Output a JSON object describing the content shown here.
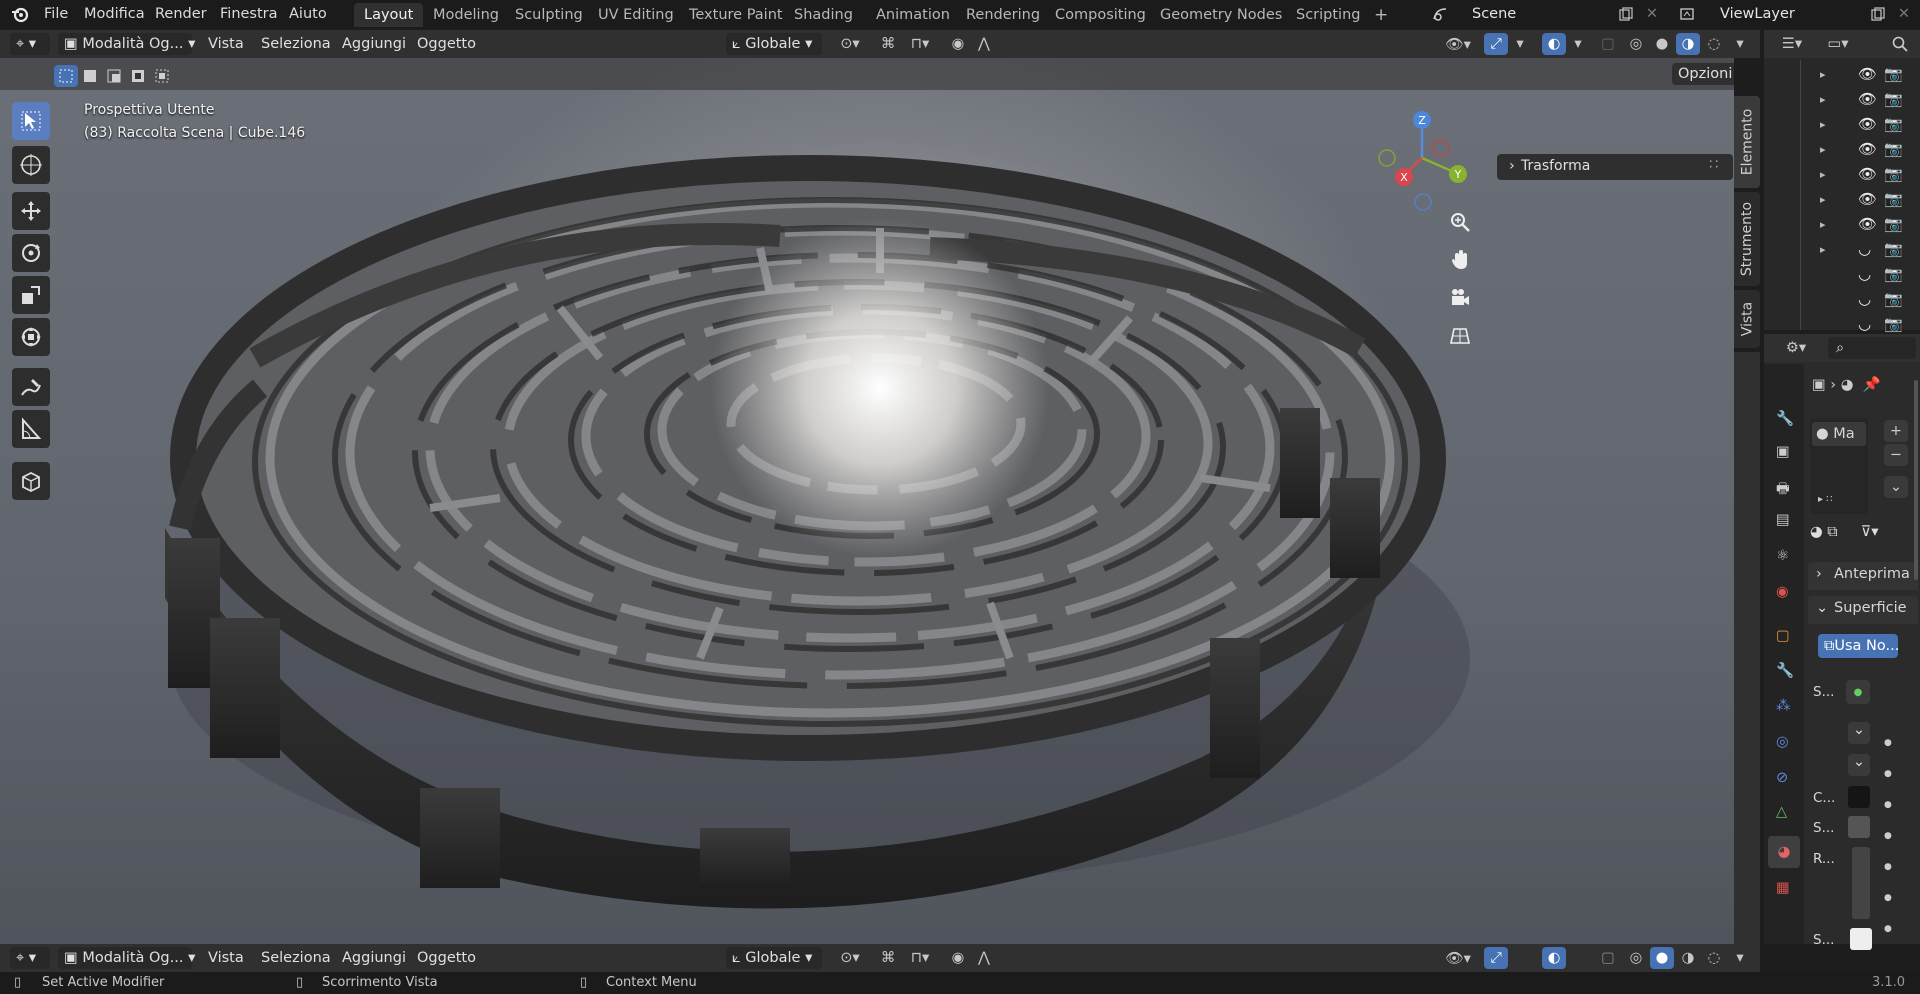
{
  "topbar": {
    "menus": [
      "File",
      "Modifica",
      "Render",
      "Finestra",
      "Aiuto"
    ],
    "workspaces": [
      "Layout",
      "Modeling",
      "Sculpting",
      "UV Editing",
      "Texture Paint",
      "Shading",
      "Animation",
      "Rendering",
      "Compositing",
      "Geometry Nodes",
      "Scripting"
    ],
    "active_workspace": "Layout",
    "add_workspace": "+",
    "scene_label": "Scene",
    "view_layer_label": "ViewLayer"
  },
  "viewport_header": {
    "mode": "Modalità Og...",
    "menus": [
      "Vista",
      "Seleziona",
      "Aggiungi",
      "Oggetto"
    ],
    "transform_orientation": "Globale",
    "options_label": "Opzioni"
  },
  "viewport": {
    "view_name": "Prospettiva Utente",
    "object_info": "(83) Raccolta Scena | Cube.146",
    "npanel_section": "Trasforma",
    "side_tabs": [
      "Elemento",
      "Strumento",
      "Vista"
    ],
    "gizmo_axes": {
      "z": "Z",
      "y": "Y",
      "x": "X"
    }
  },
  "properties": {
    "material_slot": "Ma",
    "preview_panel": "Anteprima",
    "surface_panel": "Superficie",
    "use_nodes_button": "Usa No...",
    "rows": [
      "S...",
      "C...",
      "S...",
      "R...",
      "S..."
    ],
    "colors": {
      "accent": "#4772b3",
      "bg": "#2b2b2b"
    }
  },
  "statusbar": {
    "left": "Set Active Modifier",
    "middle": "Scorrimento Vista",
    "right": "Context Menu",
    "version": "3.1.0"
  }
}
